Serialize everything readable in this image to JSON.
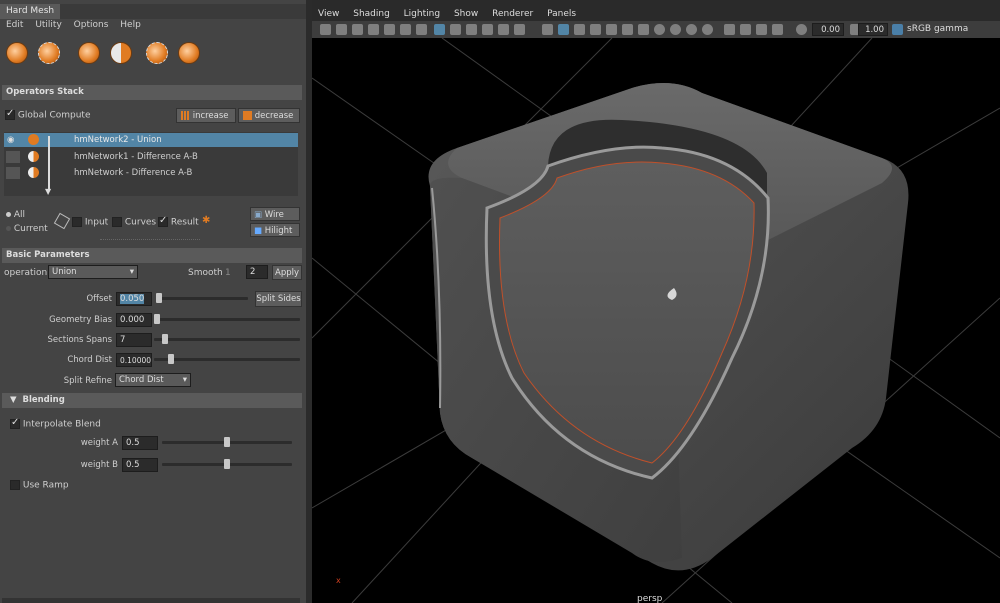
{
  "window": {
    "title": "Hard Mesh"
  },
  "left_menu": [
    "Edit",
    "Utility",
    "Options",
    "Help"
  ],
  "toolbar_icons": [
    "sphere-icon",
    "sphere-dash-icon",
    "sphere-icon",
    "half-sphere-icon",
    "sphere-dash-icon",
    "sphere-icon"
  ],
  "operators": {
    "header": "Operators Stack",
    "global_compute": "Global Compute",
    "increase": "increase",
    "decrease": "decrease",
    "rows": [
      {
        "label": "hmNetwork2 - Union",
        "selected": true
      },
      {
        "label": "hmNetwork1 - Difference A-B",
        "selected": false
      },
      {
        "label": "hmNetwork - Difference A-B",
        "selected": false
      }
    ]
  },
  "display": {
    "all": "All",
    "current": "Current",
    "input": "Input",
    "curves": "Curves",
    "result": "Result",
    "wire": "Wire",
    "hilight": "Hilight"
  },
  "basic": {
    "header": "Basic Parameters",
    "operation_label": "operation",
    "operation_value": "Union",
    "smooth_label": "Smooth",
    "smooth_small": "1",
    "smooth_value": "2",
    "apply": "Apply",
    "offset_label": "Offset",
    "offset_value": "0.050",
    "split_sides": "Split Sides",
    "geometry_bias_label": "Geometry Bias",
    "geometry_bias_value": "0.000",
    "sections_spans_label": "Sections Spans",
    "sections_spans_value": "7",
    "chord_dist_label": "Chord Dist",
    "chord_dist_value": "0.100000",
    "split_refine_label": "Split Refine",
    "split_refine_value": "Chord Dist"
  },
  "blending": {
    "header": "Blending",
    "interpolate": "Interpolate Blend",
    "weight_a_label": "weight A",
    "weight_a_value": "0.5",
    "weight_b_label": "weight B",
    "weight_b_value": "0.5",
    "use_ramp": "Use Ramp"
  },
  "viewport": {
    "menu": [
      "View",
      "Shading",
      "Lighting",
      "Show",
      "Renderer",
      "Panels"
    ],
    "exposure": "0.00",
    "gamma": "1.00",
    "colorspace": "sRGB gamma",
    "camera": "persp"
  },
  "colors": {
    "accent": "#5285a6",
    "panel": "#444444",
    "header": "#5a5a5a",
    "viewport_bg": "#000000",
    "outline": "#c0502a"
  }
}
